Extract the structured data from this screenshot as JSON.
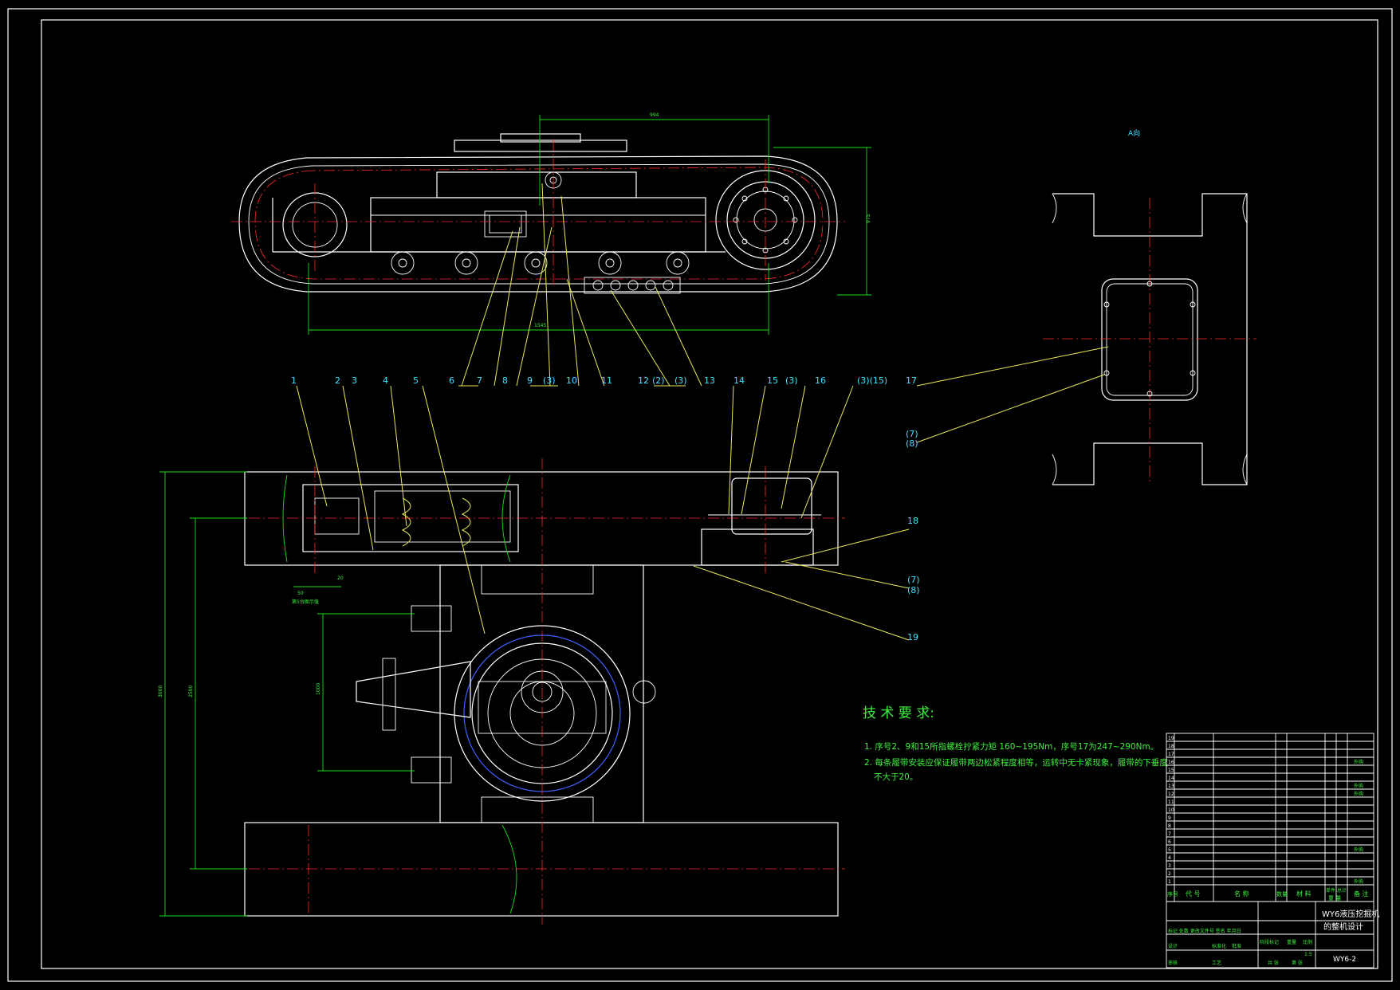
{
  "view_label": "A向",
  "dimensions": {
    "top_width": "994",
    "top_height": "975",
    "overall_length": "1545",
    "left_overall": "3000",
    "left_inner": "2500",
    "left_mid": "1000",
    "small_a": "50",
    "small_b": "20",
    "small_note": "第5台图示值"
  },
  "callouts": [
    "1",
    "2",
    "3",
    "4",
    "5",
    "6",
    "7",
    "8",
    "9",
    "(3)",
    "10",
    "11",
    "12",
    "(2)",
    "(3)",
    "13",
    "14",
    "15",
    "(3)",
    "16",
    "(3)(15)",
    "17",
    "(7)",
    "(8)",
    "18",
    "(7)",
    "(8)",
    "19"
  ],
  "tech": {
    "heading": "技 术 要 求:",
    "line1": "1. 序号2、9和15所指螺栓拧紧力矩 160~195Nm，序号17为247~290Nm。",
    "line2": "2. 每条履带安装应保证履带两边松紧程度相等，运转中无卡紧现象，履带的下垂度",
    "line3": "不大于20。"
  },
  "bom_header": {
    "no": "序号",
    "code": "代 号",
    "name": "名 称",
    "qty": "数量",
    "material": "材 料",
    "unit_weight": "单件",
    "total_weight": "总计",
    "weight_group": "重 量",
    "remark": "备 注"
  },
  "bom_rows": [
    {
      "no": "19",
      "code": "",
      "name": "",
      "qty": "",
      "material": "",
      "remark": ""
    },
    {
      "no": "18",
      "code": "",
      "name": "",
      "qty": "",
      "material": "",
      "remark": ""
    },
    {
      "no": "17",
      "code": "",
      "name": "",
      "qty": "",
      "material": "",
      "remark": ""
    },
    {
      "no": "16",
      "code": "",
      "name": "",
      "qty": "",
      "material": "",
      "remark": "外购"
    },
    {
      "no": "15",
      "code": "",
      "name": "",
      "qty": "",
      "material": "",
      "remark": ""
    },
    {
      "no": "14",
      "code": "",
      "name": "",
      "qty": "",
      "material": "",
      "remark": ""
    },
    {
      "no": "13",
      "code": "",
      "name": "",
      "qty": "",
      "material": "",
      "remark": "外购"
    },
    {
      "no": "12",
      "code": "",
      "name": "",
      "qty": "",
      "material": "",
      "remark": "外购"
    },
    {
      "no": "11",
      "code": "",
      "name": "",
      "qty": "",
      "material": "",
      "remark": ""
    },
    {
      "no": "10",
      "code": "",
      "name": "",
      "qty": "",
      "material": "",
      "remark": ""
    },
    {
      "no": "9",
      "code": "",
      "name": "",
      "qty": "",
      "material": "",
      "remark": ""
    },
    {
      "no": "8",
      "code": "",
      "name": "",
      "qty": "",
      "material": "",
      "remark": ""
    },
    {
      "no": "7",
      "code": "",
      "name": "",
      "qty": "",
      "material": "",
      "remark": ""
    },
    {
      "no": "6",
      "code": "",
      "name": "",
      "qty": "",
      "material": "",
      "remark": ""
    },
    {
      "no": "5",
      "code": "",
      "name": "",
      "qty": "",
      "material": "",
      "remark": "外购"
    },
    {
      "no": "4",
      "code": "",
      "name": "",
      "qty": "",
      "material": "",
      "remark": ""
    },
    {
      "no": "3",
      "code": "",
      "name": "",
      "qty": "",
      "material": "",
      "remark": ""
    },
    {
      "no": "2",
      "code": "",
      "name": "",
      "qty": "",
      "material": "",
      "remark": ""
    },
    {
      "no": "1",
      "code": "",
      "name": "",
      "qty": "",
      "material": "",
      "remark": "外购"
    }
  ],
  "title_block": {
    "title_line1": "WY6液压挖掘机",
    "title_line2": "的整机设计",
    "drawing_no": "WY6-2",
    "revision_labels": "标记  处数  更改文件号  签名  年月日",
    "design": "设计",
    "standard": "标准化",
    "review": "审核",
    "process": "工艺",
    "approve": "批准",
    "stage_mark": "阶段标记",
    "weight": "重量",
    "scale": "比例",
    "scale_value": "1:5",
    "sheets": "共 张",
    "sheet": "第 张"
  }
}
